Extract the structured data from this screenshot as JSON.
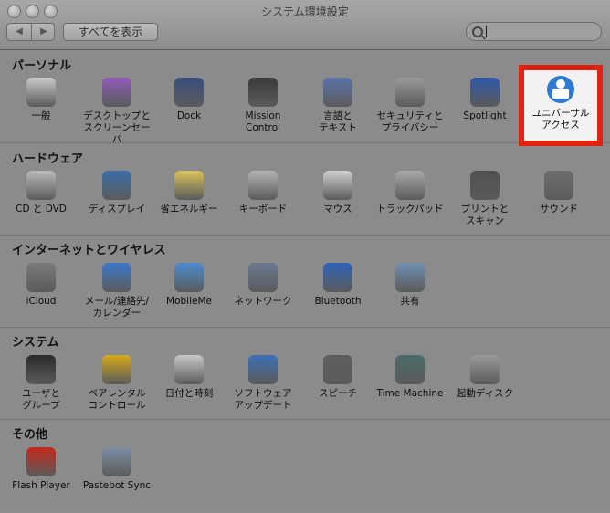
{
  "window": {
    "title": "システム環境設定",
    "show_all_label": "すべてを表示",
    "nav_back": "◀",
    "nav_forward": "▶"
  },
  "search": {
    "placeholder": "",
    "value": ""
  },
  "sections": [
    {
      "label": "パーソナル",
      "items": [
        {
          "label": "一般",
          "icon": "general-icon",
          "color": "#c9c9c9"
        },
        {
          "label": "デスクトップと\nスクリーンセーバ",
          "icon": "desktop-icon",
          "color": "#8e5bb8"
        },
        {
          "label": "Dock",
          "icon": "dock-icon",
          "color": "#3a4d7d"
        },
        {
          "label": "Mission\nControl",
          "icon": "mission-control-icon",
          "color": "#3a3a3a"
        },
        {
          "label": "言語と\nテキスト",
          "icon": "language-icon",
          "color": "#5a74a8"
        },
        {
          "label": "セキュリティと\nプライバシー",
          "icon": "security-icon",
          "color": "#9a9a9a"
        },
        {
          "label": "Spotlight",
          "icon": "spotlight-icon",
          "color": "#2f56a6"
        },
        {
          "label": "ユニバーサル\nアクセス",
          "icon": "universal-access-icon",
          "color": "#2d79d4"
        }
      ]
    },
    {
      "label": "ハードウェア",
      "items": [
        {
          "label": "CD と DVD",
          "icon": "cd-dvd-icon",
          "color": "#b9b9b9"
        },
        {
          "label": "ディスプレイ",
          "icon": "display-icon",
          "color": "#3b6ea8"
        },
        {
          "label": "省エネルギー",
          "icon": "energy-saver-icon",
          "color": "#d8c25a"
        },
        {
          "label": "キーボード",
          "icon": "keyboard-icon",
          "color": "#b2b2b2"
        },
        {
          "label": "マウス",
          "icon": "mouse-icon",
          "color": "#cfcfcf"
        },
        {
          "label": "トラックパッド",
          "icon": "trackpad-icon",
          "color": "#a8a8a8"
        },
        {
          "label": "プリントと\nスキャン",
          "icon": "printer-icon",
          "color": "#505050"
        },
        {
          "label": "サウンド",
          "icon": "sound-icon",
          "color": "#6e6e6e"
        }
      ]
    },
    {
      "label": "インターネットとワイヤレス",
      "items": [
        {
          "label": "iCloud",
          "icon": "icloud-icon",
          "color": "#7a7a7a"
        },
        {
          "label": "メール/連絡先/\nカレンダー",
          "icon": "mail-icon",
          "color": "#3b78c9"
        },
        {
          "label": "MobileMe",
          "icon": "mobileme-icon",
          "color": "#4c8bd0"
        },
        {
          "label": "ネットワーク",
          "icon": "network-icon",
          "color": "#6a7890"
        },
        {
          "label": "Bluetooth",
          "icon": "bluetooth-icon",
          "color": "#2f63b8"
        },
        {
          "label": "共有",
          "icon": "sharing-icon",
          "color": "#6f8fb2"
        }
      ]
    },
    {
      "label": "システム",
      "items": [
        {
          "label": "ユーザと\nグループ",
          "icon": "users-icon",
          "color": "#2a2a2a"
        },
        {
          "label": "ペアレンタル\nコントロール",
          "icon": "parental-controls-icon",
          "color": "#d6a91a"
        },
        {
          "label": "日付と時刻",
          "icon": "date-time-icon",
          "color": "#c8c8c8"
        },
        {
          "label": "ソフトウェア\nアップデート",
          "icon": "software-update-icon",
          "color": "#3b6fb6"
        },
        {
          "label": "スピーチ",
          "icon": "speech-icon",
          "color": "#5e5e5e"
        },
        {
          "label": "Time Machine",
          "icon": "time-machine-icon",
          "color": "#4a6a6a"
        },
        {
          "label": "起動ディスク",
          "icon": "startup-disk-icon",
          "color": "#9a9a9a"
        }
      ]
    },
    {
      "label": "その他",
      "items": [
        {
          "label": "Flash Player",
          "icon": "flash-player-icon",
          "color": "#c4281c"
        },
        {
          "label": "Pastebot Sync",
          "icon": "pastebot-sync-icon",
          "color": "#7b8ea5"
        }
      ]
    }
  ]
}
